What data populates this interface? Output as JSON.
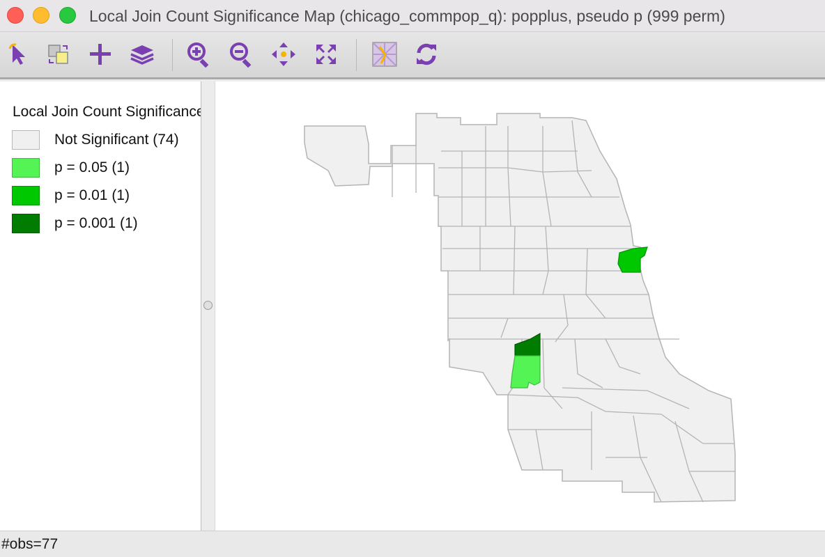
{
  "window": {
    "title": "Local Join Count Significance Map (chicago_commpop_q): popplus, pseudo p (999 perm)"
  },
  "toolbar": {
    "buttons": [
      {
        "icon": "select-pointer-icon",
        "label": ""
      },
      {
        "icon": "selection-mode-icon",
        "label": ""
      },
      {
        "icon": "add-layer-plus-icon",
        "label": ""
      },
      {
        "icon": "layers-icon",
        "label": ""
      },
      {
        "icon": "zoom-in-icon",
        "label": ""
      },
      {
        "icon": "zoom-out-icon",
        "label": ""
      },
      {
        "icon": "pan-icon",
        "label": ""
      },
      {
        "icon": "fit-extent-icon",
        "label": ""
      },
      {
        "icon": "basemap-icon",
        "label": ""
      },
      {
        "icon": "refresh-icon",
        "label": ""
      }
    ],
    "accent_color": "#7a3fb0"
  },
  "legend": {
    "title": "Local Join Count Significance",
    "items": [
      {
        "label": "Not Significant (74)",
        "color": "#f0f0f0",
        "border": "#b8b8b8"
      },
      {
        "label": "p = 0.05 (1)",
        "color": "#55f455",
        "border": "#3bbd3b"
      },
      {
        "label": "p = 0.01 (1)",
        "color": "#00c800",
        "border": "#009600"
      },
      {
        "label": "p = 0.001 (1)",
        "color": "#007d00",
        "border": "#005a00"
      }
    ]
  },
  "map": {
    "base_fill": "#f0f0f0",
    "boundary_color": "#b4b4b4"
  },
  "status": {
    "text": "#obs=77"
  }
}
